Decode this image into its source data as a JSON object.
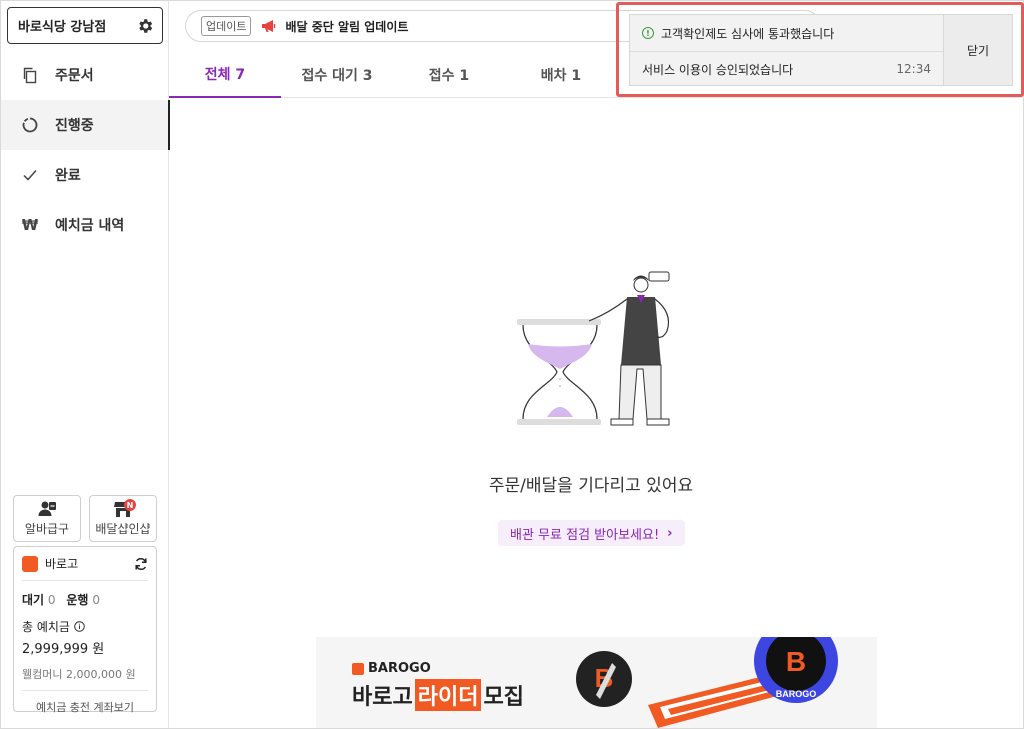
{
  "sidebar": {
    "store_name": "바로식당 강남점",
    "nav": [
      {
        "label": "주문서"
      },
      {
        "label": "진행중"
      },
      {
        "label": "완료"
      },
      {
        "label": "예치금 내역"
      }
    ],
    "tiles": [
      {
        "label": "알바급구"
      },
      {
        "label": "배달샵인샵",
        "badge": "N"
      }
    ],
    "barogo": {
      "name": "바로고",
      "waiting_label": "대기",
      "waiting_count": "0",
      "running_label": "운행",
      "running_count": "0",
      "total_label": "총 예치금",
      "total_amount": "2,999,999 원",
      "welcome_money": "웰컴머니 2,000,000 원",
      "deposit_link": "예치금 충전 계좌보기"
    }
  },
  "topbar": {
    "tag": "업데이트",
    "notice": "배달 중단 알림 업데이트"
  },
  "tabs": [
    {
      "label": "전체 7"
    },
    {
      "label": "접수 대기 3"
    },
    {
      "label": "접수 1"
    },
    {
      "label": "배차 1"
    }
  ],
  "empty": {
    "message": "주문/배달을 기다리고 있어요",
    "promo": "배관 무료 점검 받아보세요!"
  },
  "banner": {
    "brand": "BAROGO",
    "head_pre": "바로고",
    "head_highlight": "라이더",
    "head_post": "모집",
    "seal_text": "BAROGO"
  },
  "toast": {
    "title": "고객확인제도 심사에 통과했습니다",
    "message": "서비스 이용이 승인되었습니다",
    "time": "12:34",
    "close_label": "닫기"
  },
  "colors": {
    "accent": "#8a27b5",
    "brand": "#f15a22",
    "alert_outline": "#e35b5b"
  }
}
